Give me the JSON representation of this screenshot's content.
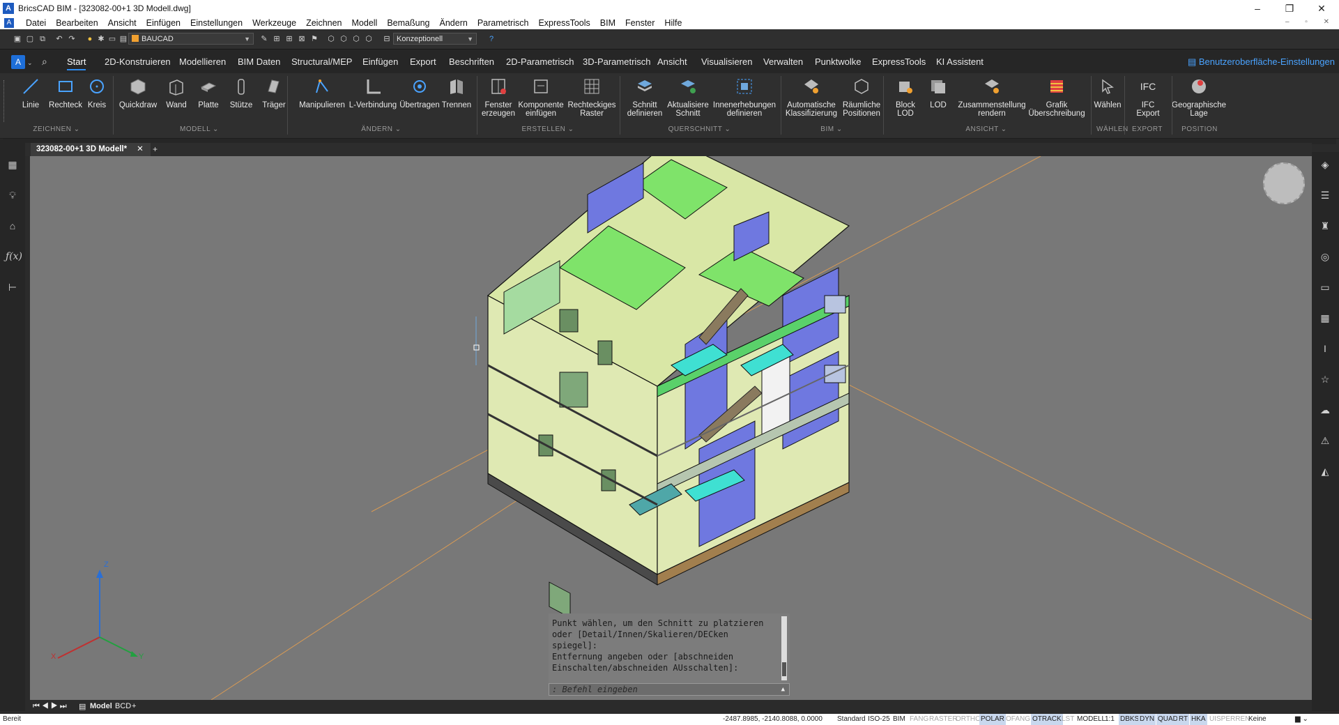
{
  "window": {
    "title": "BricsCAD BIM - [323082-00+1 3D Modell.dwg]",
    "logo_glyph": "A",
    "controls": {
      "minimize": "–",
      "restore": "❐",
      "close": "✕"
    }
  },
  "menubar": {
    "items": [
      "Datei",
      "Bearbeiten",
      "Ansicht",
      "Einfügen",
      "Einstellungen",
      "Werkzeuge",
      "Zeichnen",
      "Modell",
      "Bemaßung",
      "Ändern",
      "Parametrisch",
      "ExpressTools",
      "BIM",
      "Fenster",
      "Hilfe"
    ],
    "doc_controls": "– ▫ ✕"
  },
  "quickaccess": {
    "layer_dropdown": "BAUCAD",
    "visualstyle_dropdown": "Konzeptionell"
  },
  "ribbon_tabs": {
    "items": [
      "Start",
      "2D-Konstruieren",
      "Modellieren",
      "BIM Daten",
      "Structural/MEP",
      "Einfügen",
      "Export",
      "Beschriften",
      "2D-Parametrisch",
      "3D-Parametrisch",
      "Ansicht",
      "Visualisieren",
      "Verwalten",
      "Punktwolke",
      "ExpressTools",
      "KI Assistent"
    ],
    "active": "Start",
    "ui_settings": "Benutzeroberfläche-Einstellungen"
  },
  "ribbon": {
    "buttons": [
      {
        "l1": "Linie",
        "l2": ""
      },
      {
        "l1": "Rechteck",
        "l2": ""
      },
      {
        "l1": "Kreis",
        "l2": ""
      },
      {
        "l1": "Quickdraw",
        "l2": ""
      },
      {
        "l1": "Wand",
        "l2": ""
      },
      {
        "l1": "Platte",
        "l2": ""
      },
      {
        "l1": "Stütze",
        "l2": ""
      },
      {
        "l1": "Träger",
        "l2": ""
      },
      {
        "l1": "Manipulieren",
        "l2": ""
      },
      {
        "l1": "L-Verbindung",
        "l2": ""
      },
      {
        "l1": "Übertragen",
        "l2": ""
      },
      {
        "l1": "Trennen",
        "l2": ""
      },
      {
        "l1": "Fenster",
        "l2": "erzeugen"
      },
      {
        "l1": "Komponente",
        "l2": "einfügen"
      },
      {
        "l1": "Rechteckiges",
        "l2": "Raster"
      },
      {
        "l1": "Schnitt",
        "l2": "definieren"
      },
      {
        "l1": "Aktualisiere",
        "l2": "Schnitt"
      },
      {
        "l1": "Innenerhebungen",
        "l2": "definieren"
      },
      {
        "l1": "Automatische",
        "l2": "Klassifizierung"
      },
      {
        "l1": "Räumliche",
        "l2": "Positionen"
      },
      {
        "l1": "Block",
        "l2": "LOD"
      },
      {
        "l1": "LOD",
        "l2": ""
      },
      {
        "l1": "Zusammenstellung",
        "l2": "rendern"
      },
      {
        "l1": "Grafik",
        "l2": "Überschreibung"
      },
      {
        "l1": "Wählen",
        "l2": ""
      },
      {
        "l1": "IFC",
        "l2": "Export"
      },
      {
        "l1": "Geographische",
        "l2": "Lage"
      }
    ],
    "groups": [
      "ZEICHNEN ⌄",
      "MODELL ⌄",
      "ÄNDERN ⌄",
      "ERSTELLEN ⌄",
      "QUERSCHNITT ⌄",
      "BIM ⌄",
      "ANSICHT ⌄",
      "WÄHLEN",
      "EXPORT",
      "POSITION"
    ],
    "ifc_glyph": "IFC"
  },
  "document_tab": {
    "name": "323082-00+1 3D Modell*",
    "close": "✕",
    "add": "+"
  },
  "command": {
    "history": "Punkt wählen, um den Schnitt zu platzieren\noder [Detail/Innen/Skalieren/DECken\nspiegel]:\nEntfernung angeben oder [abschneiden\nEinschalten/abschneiden AUsschalten]:",
    "placeholder": ": Befehl eingeben"
  },
  "layout_tabs": {
    "nav": "⏮ ◀ ▶ ⏭",
    "model": "Model",
    "layout": "BCD",
    "add": "+"
  },
  "axes": {
    "x": "X",
    "y": "Y",
    "z": "Z"
  },
  "statusbar": {
    "ready": "Bereit",
    "coords": "-2487.8985, -2140.8088, 0.0000",
    "items": [
      {
        "t": "Standard",
        "s": "n"
      },
      {
        "t": "ISO-25",
        "s": "n"
      },
      {
        "t": "BIM",
        "s": "n"
      },
      {
        "t": "FANG",
        "s": "off"
      },
      {
        "t": "RASTER",
        "s": "off"
      },
      {
        "t": "ORTHO",
        "s": "off"
      },
      {
        "t": "POLAR",
        "s": "on"
      },
      {
        "t": "OFANG",
        "s": "off"
      },
      {
        "t": "OTRACK",
        "s": "on"
      },
      {
        "t": "LST",
        "s": "off"
      },
      {
        "t": "MODELL",
        "s": "n"
      },
      {
        "t": "1:1",
        "s": "n"
      },
      {
        "t": "DBKS",
        "s": "on"
      },
      {
        "t": "DYN",
        "s": "on"
      },
      {
        "t": "QUAD",
        "s": "on"
      },
      {
        "t": "RT",
        "s": "on"
      },
      {
        "t": "HKA",
        "s": "on"
      },
      {
        "t": "UISPERREN",
        "s": "off"
      },
      {
        "t": "Keine",
        "s": "n"
      }
    ]
  },
  "colors": {
    "accent": "#2d8cf0",
    "viewport": "#787878",
    "wall": "#e3edb5",
    "floor_green": "#7fe36a",
    "wall_blue": "#6f78e0",
    "stair_cyan": "#3fe0d2"
  }
}
